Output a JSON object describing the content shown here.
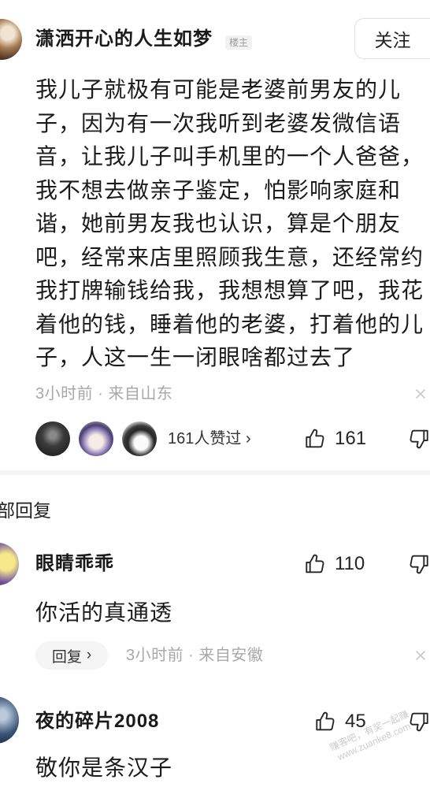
{
  "post": {
    "author": {
      "name": "潇洒开心的人生如梦",
      "badge": "楼主"
    },
    "follow_label": "关注",
    "body_lines": [
      "我儿子就极有可能是老婆前男友的儿",
      "子，因为有一次我听到老婆发微信语",
      "音，让我儿子叫手机里的一个人爸爸，",
      "我不想去做亲子鉴定，怕影响家庭和",
      "谐，她前男友我也认识，算是个朋友",
      "吧，经常来店里照顾我生意，还经常约",
      "我打牌输钱给我，我想想算了吧，我花",
      "着他的钱，睡着他的老婆，打着他的儿",
      "子，人这一生一闭眼啥都过去了"
    ],
    "meta": "3小时前 · 来自山东",
    "likes": {
      "summary": "161人赞过",
      "chevron": "›",
      "count": "161"
    }
  },
  "replies_header": "部回复",
  "comments": [
    {
      "author": "眼睛乖乖",
      "like_count": "110",
      "text": "你活的真通透",
      "reply_label": "回复",
      "reply_chevron": "›",
      "meta": "3小时前 · 来自安徽"
    },
    {
      "author": "夜的碎片2008",
      "like_count": "45",
      "text": "敬你是条汉子"
    }
  ],
  "watermark": {
    "line1": "赚客吧，有奖一起赚",
    "line2": "www.zuanke8.com"
  },
  "icons": {
    "like": "thumbs-up-icon",
    "dislike": "thumbs-down-icon",
    "close": "close-icon",
    "chevron": "chevron-right-icon",
    "avatar": "avatar"
  },
  "colors": {
    "text_primary": "#1c1c1c",
    "text_secondary": "#a8a8a8",
    "divider": "#f5f5f5",
    "background": "#ffffff"
  }
}
